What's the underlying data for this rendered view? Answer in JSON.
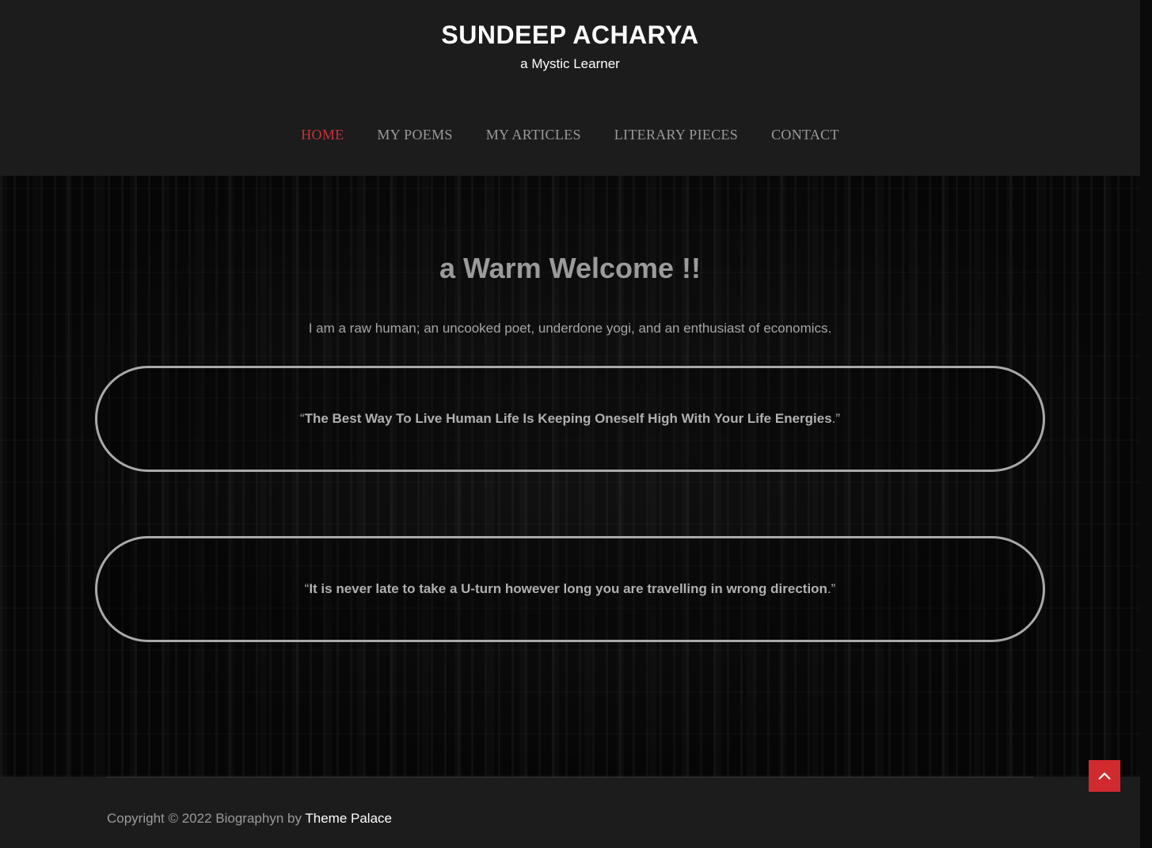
{
  "header": {
    "site_title": "SUNDEEP ACHARYA",
    "tagline": "a Mystic Learner"
  },
  "nav": {
    "items": [
      {
        "label": "HOME",
        "active": true
      },
      {
        "label": "MY POEMS",
        "active": false
      },
      {
        "label": "MY ARTICLES",
        "active": false
      },
      {
        "label": "LITERARY PIECES",
        "active": false
      },
      {
        "label": "CONTACT",
        "active": false
      }
    ]
  },
  "hero": {
    "heading": "a Warm Welcome !!",
    "intro": "I am a raw human; an uncooked poet, underdone yogi, and an enthusiast of economics."
  },
  "quotes": [
    {
      "open": "“",
      "text": "The Best Way To Live Human Life Is Keeping Oneself High With Your Life Energies",
      "close": ".”"
    },
    {
      "open": "“",
      "text": "It is never late to take a U-turn however long you are travelling in wrong direction",
      "close": ".”"
    }
  ],
  "footer": {
    "copyright_prefix": "Copyright © 2022 Biographyn by ",
    "theme_link": "Theme Palace"
  },
  "icons": {
    "back_to_top": "chevron-up-icon"
  },
  "colors": {
    "accent": "#d02a2f",
    "active_nav": "#c8343a",
    "header_bg": "#1c1c1c"
  }
}
